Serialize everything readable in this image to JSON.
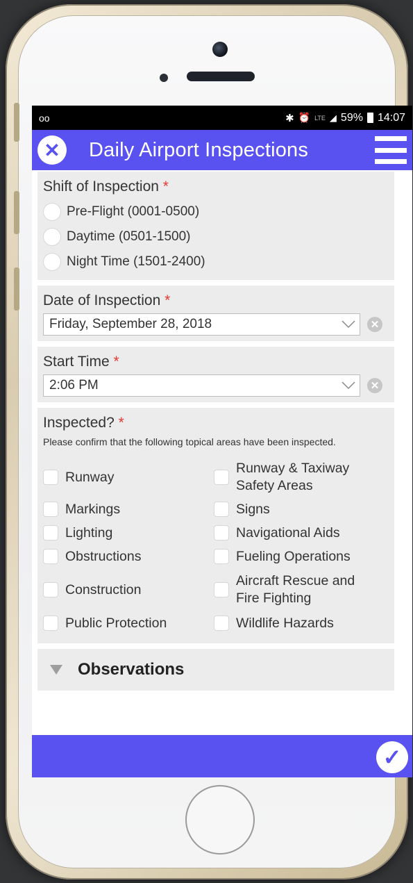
{
  "status_bar": {
    "left_icon": "voicemail-icon",
    "network": "LTE",
    "battery": "59%",
    "time": "14:07"
  },
  "app_bar": {
    "title": "Daily Airport Inspections",
    "close_icon": "close-icon",
    "menu_icon": "hamburger-menu-icon"
  },
  "shift": {
    "label": "Shift of Inspection",
    "required_mark": "*",
    "options": [
      "Pre-Flight (0001-0500)",
      "Daytime (0501-1500)",
      "Night Time (1501-2400)"
    ]
  },
  "date": {
    "label": "Date of Inspection",
    "required_mark": "*",
    "value": "Friday, September 28, 2018"
  },
  "start_time": {
    "label": "Start Time",
    "required_mark": "*",
    "value": "2:06 PM"
  },
  "inspected": {
    "label": "Inspected?",
    "required_mark": "*",
    "help": "Please confirm that the following topical areas have been inspected.",
    "items": [
      "Runway",
      "Runway & Taxiway Safety Areas",
      "Markings",
      "Signs",
      "Lighting",
      "Navigational Aids",
      "Obstructions",
      "Fueling Operations",
      "Construction",
      "Aircraft Rescue and Fire Fighting",
      "Public Protection",
      "Wildlife Hazards"
    ]
  },
  "observations": {
    "label": "Observations"
  },
  "colors": {
    "accent": "#5a52f0",
    "required": "#e53935",
    "section_bg": "#ececec"
  }
}
